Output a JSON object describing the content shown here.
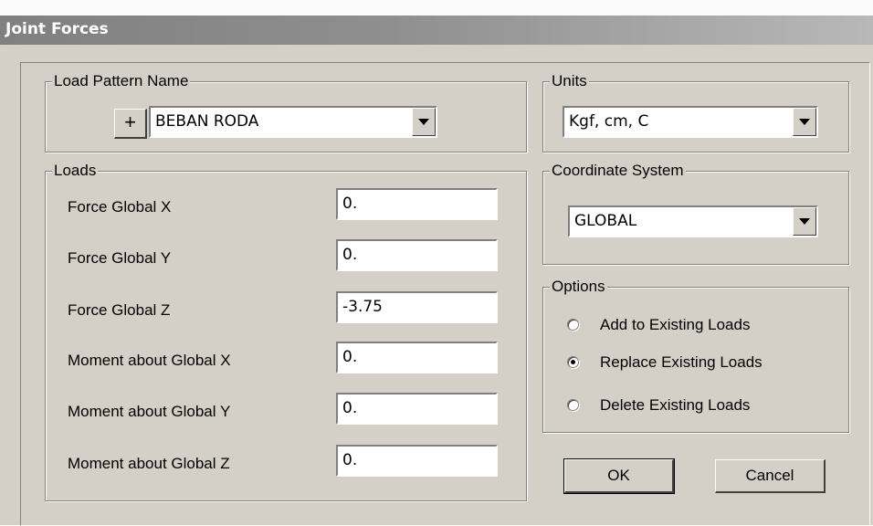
{
  "dialog": {
    "title": "Joint Forces"
  },
  "load_pattern": {
    "legend": "Load Pattern Name",
    "add_label": "+",
    "selected": "BEBAN RODA"
  },
  "units": {
    "legend": "Units",
    "selected": "Kgf, cm, C"
  },
  "coordinate_system": {
    "legend": "Coordinate System",
    "selected": "GLOBAL"
  },
  "loads": {
    "legend": "Loads",
    "rows": [
      {
        "label": "Force Global X",
        "value": "0."
      },
      {
        "label": "Force Global Y",
        "value": "0."
      },
      {
        "label": "Force Global Z",
        "value": "-3.75"
      },
      {
        "label": "Moment about Global X",
        "value": "0."
      },
      {
        "label": "Moment about Global Y",
        "value": "0."
      },
      {
        "label": "Moment about Global Z",
        "value": "0."
      }
    ]
  },
  "options": {
    "legend": "Options",
    "items": [
      {
        "label": "Add to Existing Loads",
        "selected": false
      },
      {
        "label": "Replace Existing Loads",
        "selected": true
      },
      {
        "label": "Delete Existing Loads",
        "selected": false
      }
    ]
  },
  "buttons": {
    "ok": "OK",
    "cancel": "Cancel"
  }
}
